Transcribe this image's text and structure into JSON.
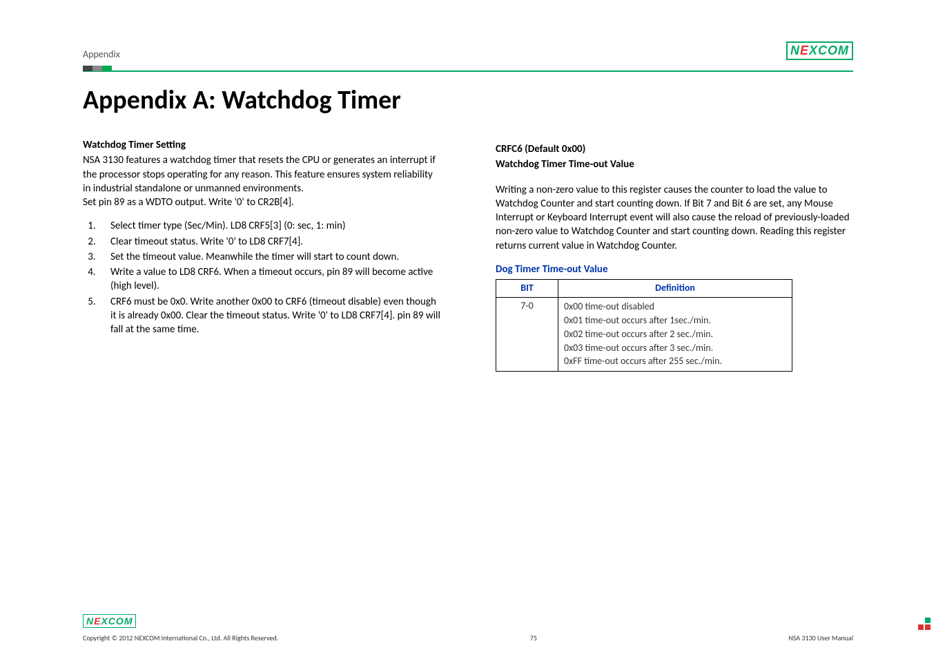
{
  "header": {
    "label": "Appendix",
    "logo_text_left": "N",
    "logo_text_e": "E",
    "logo_text_right": "COM",
    "logo_text_x": "X"
  },
  "title": "Appendix A: Watchdog Timer",
  "left": {
    "heading": "Watchdog Timer Setting",
    "intro": "NSA 3130 features a watchdog timer that resets the CPU or generates an interrupt if the processor stops operating for any reason. This feature ensures system reliability in industrial standalone or unmanned environments.",
    "setpin": "Set pin 89 as a WDTO output. Write '0' to CR2B[4].",
    "steps": [
      "Select timer type (Sec/Min). LD8 CRF5[3] (0: sec, 1: min)",
      "Clear timeout status. Write '0' to LD8 CRF7[4].",
      "Set the timeout value. Meanwhile the timer will start to count down.",
      "Write a value to LD8 CRF6. When a timeout occurs, pin 89 will become active (high level).",
      "CRF6 must be 0x0. Write another 0x00 to CRF6 (timeout disable) even though it is already 0x00. Clear the timeout status. Write '0' to LD8 CRF7[4]. pin 89 will fall at the same time."
    ]
  },
  "right": {
    "crfc_head": "CRFC6 (Default 0x00)",
    "crfc_sub": "Watchdog Timer Time-out Value",
    "crfc_body": "Writing a non-zero value to this register causes the counter to load the value to Watchdog Counter and start counting down. If Bit 7 and Bit 6 are set, any Mouse Interrupt or Keyboard Interrupt event will also cause the reload of previously-loaded non-zero value to Watchdog Counter and start counting down. Reading this register returns current value in Watchdog Counter.",
    "table_title": "Dog Timer Time-out Value",
    "th_bit": "BIT",
    "th_def": "Definition",
    "bit_range": "7-0",
    "defs": [
      "0x00 time-out disabled",
      "0x01 time-out occurs after 1sec./min.",
      "0x02 time-out occurs after 2 sec./min.",
      "0x03 time-out occurs after 3 sec./min.",
      "0xFF time-out occurs after 255 sec./min."
    ]
  },
  "footer": {
    "copyright": "Copyright © 2012 NEXCOM International Co., Ltd. All Rights Reserved.",
    "page": "75",
    "doc": "NSA 3130 User Manual"
  }
}
